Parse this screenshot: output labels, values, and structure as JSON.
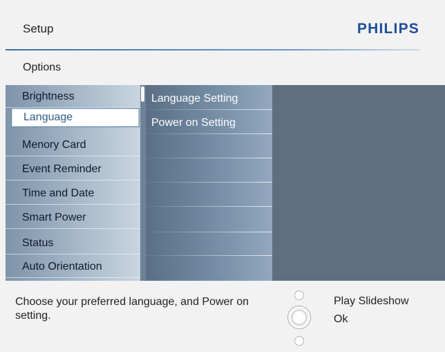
{
  "header": {
    "title": "Setup",
    "brand": "PHILIPS"
  },
  "breadcrumb": "Options",
  "menu": {
    "selected_index": 1,
    "items": [
      {
        "label": "Brightness"
      },
      {
        "label": "Language"
      },
      {
        "label": "Menory Card"
      },
      {
        "label": "Event Reminder"
      },
      {
        "label": "Time and Date"
      },
      {
        "label": "Smart Power"
      },
      {
        "label": "Status"
      },
      {
        "label": "Auto Orientation"
      }
    ]
  },
  "submenu": {
    "items": [
      {
        "label": "Language Setting"
      },
      {
        "label": "Power on Setting"
      }
    ]
  },
  "footer": {
    "help_text": "Choose your preferred language, and Power on setting.",
    "hints": {
      "up_action": "Play Slideshow",
      "ok_action": "Ok"
    }
  },
  "icons": {
    "up_button": "nav-up-button-icon",
    "ok_button": "nav-ok-button-icon",
    "down_button": "nav-down-button-icon"
  },
  "colors": {
    "brand": "#1d4f9a",
    "menu_background": "#5e6f80",
    "selected_text": "#2f5b86"
  }
}
